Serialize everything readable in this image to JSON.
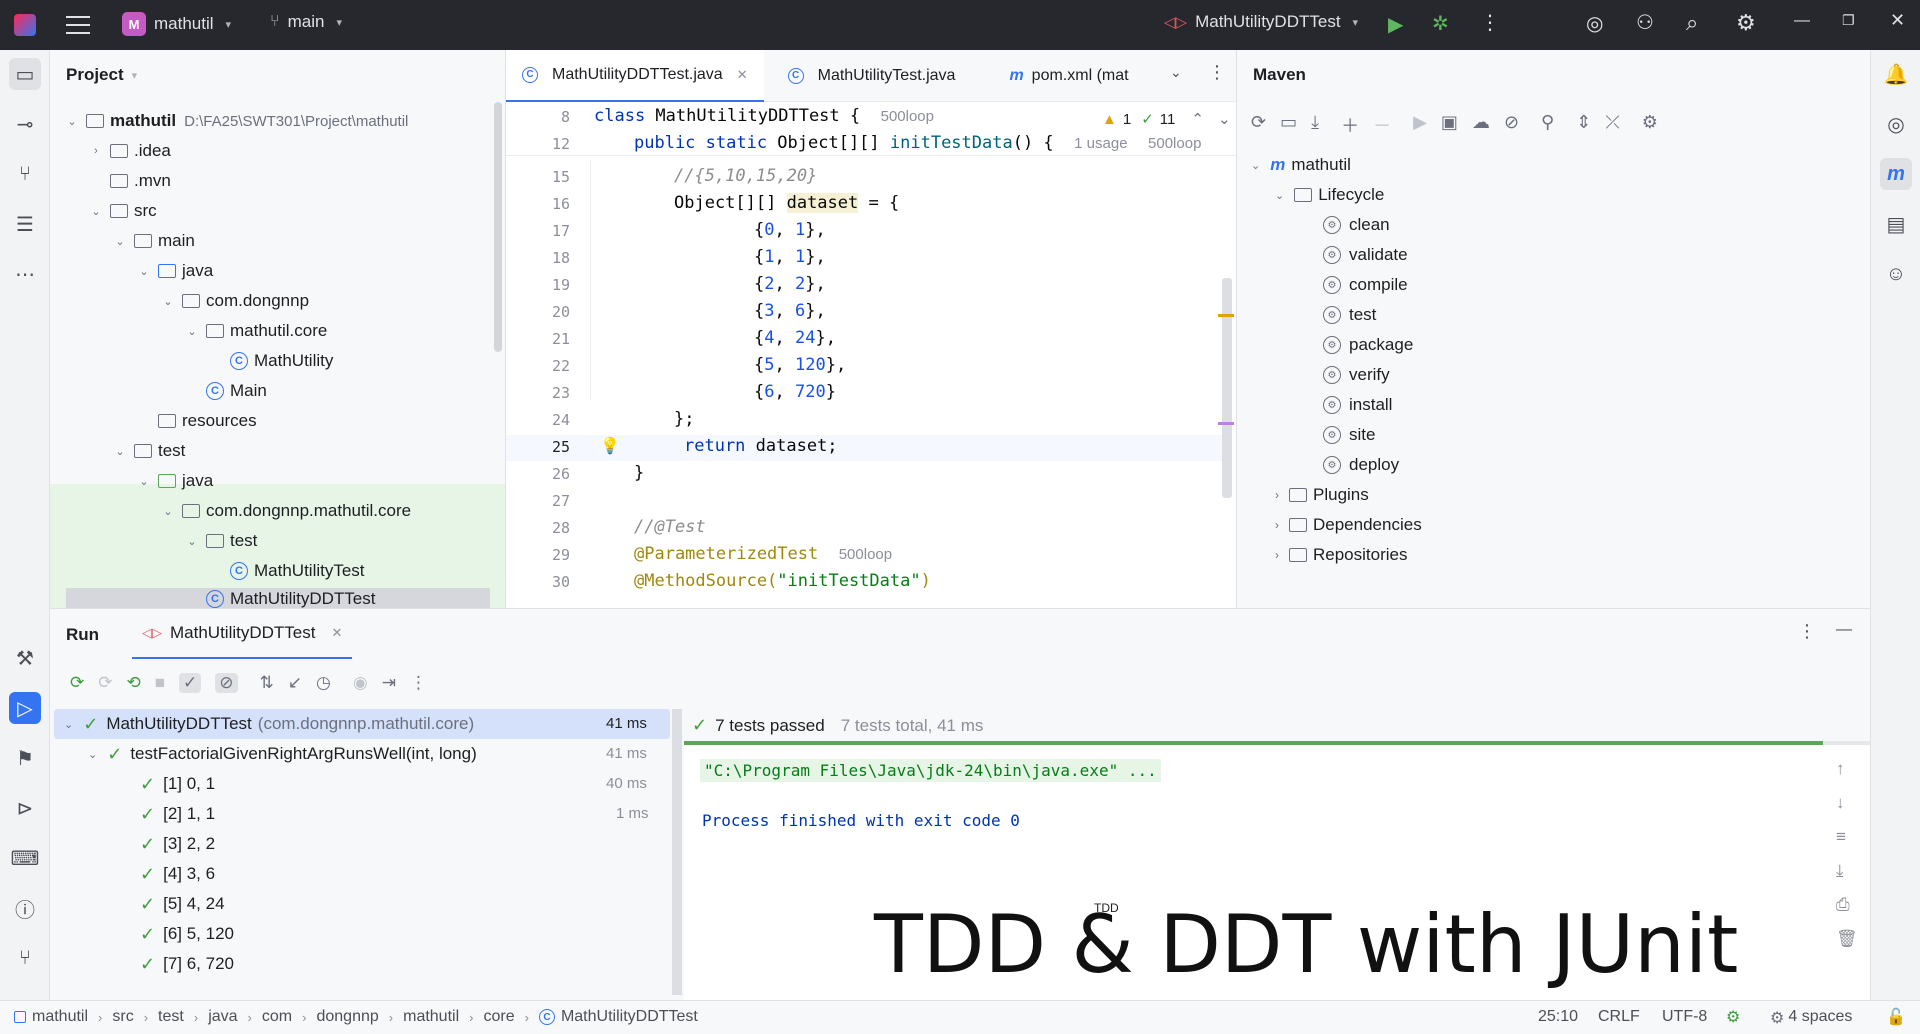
{
  "titlebar": {
    "project_badge": "M",
    "project_name": "mathutil",
    "branch": "main",
    "run_config": "MathUtilityDDTTest"
  },
  "project_panel": {
    "title": "Project",
    "tree": [
      {
        "label": "mathutil",
        "path": "D:\\FA25\\SWT301\\Project\\mathutil"
      },
      {
        "label": ".idea"
      },
      {
        "label": ".mvn"
      },
      {
        "label": "src"
      },
      {
        "label": "main"
      },
      {
        "label": "java"
      },
      {
        "label": "com.dongnnp"
      },
      {
        "label": "mathutil.core"
      },
      {
        "label": "MathUtility"
      },
      {
        "label": "Main"
      },
      {
        "label": "resources"
      },
      {
        "label": "test"
      },
      {
        "label": "java"
      },
      {
        "label": "com.dongnnp.mathutil.core"
      },
      {
        "label": "test"
      },
      {
        "label": "MathUtilityTest"
      },
      {
        "label": "MathUtilityDDTTest"
      }
    ]
  },
  "editor": {
    "tabs": [
      {
        "label": "MathUtilityDDTTest.java"
      },
      {
        "label": "MathUtilityTest.java"
      },
      {
        "label": "pom.xml (mat"
      }
    ],
    "inspections": {
      "warnings": "1",
      "ok": "11"
    },
    "hints": {
      "author": "500loop",
      "usage": "1 usage"
    },
    "lines": [
      {
        "n": "8"
      },
      {
        "n": "12"
      },
      {
        "n": "15"
      },
      {
        "n": "16"
      },
      {
        "n": "17"
      },
      {
        "n": "18"
      },
      {
        "n": "19"
      },
      {
        "n": "20"
      },
      {
        "n": "21"
      },
      {
        "n": "22"
      },
      {
        "n": "23"
      },
      {
        "n": "24"
      },
      {
        "n": "25"
      },
      {
        "n": "26"
      },
      {
        "n": "27"
      },
      {
        "n": "28"
      },
      {
        "n": "29"
      },
      {
        "n": "30"
      }
    ],
    "code": {
      "l8_kw": "class ",
      "l8_name": "MathUtilityDDTTest {",
      "l12_kw": "public static ",
      "l12_type": "Object[][] ",
      "l12_fn": "initTestData",
      "l12_rest": "() {",
      "l15": "//{5,10,15,20}",
      "l16_a": "Object[][] ",
      "l16_b": "dataset",
      "l16_c": " = {",
      "rows": [
        {
          "a": "0",
          "b": "1"
        },
        {
          "a": "1",
          "b": "1"
        },
        {
          "a": "2",
          "b": "2"
        },
        {
          "a": "3",
          "b": "6"
        },
        {
          "a": "4",
          "b": "24"
        },
        {
          "a": "5",
          "b": "120"
        },
        {
          "a": "6",
          "b": "720"
        }
      ],
      "l24": "};",
      "l25_kw": "return ",
      "l25_rest": "dataset;",
      "l26": "}",
      "l28": "//@Test",
      "l29": "@ParameterizedTest",
      "l30_ann": "@MethodSource(",
      "l30_str": "\"initTestData\"",
      "l30_end": ")"
    }
  },
  "maven": {
    "title": "Maven",
    "root": "mathutil",
    "lifecycle_label": "Lifecycle",
    "lifecycle": [
      "clean",
      "validate",
      "compile",
      "test",
      "package",
      "verify",
      "install",
      "site",
      "deploy"
    ],
    "groups": [
      "Plugins",
      "Dependencies",
      "Repositories"
    ]
  },
  "run": {
    "tab_run": "Run",
    "tab_config": "MathUtilityDDTTest",
    "root": {
      "name": "MathUtilityDDTTest",
      "pkg": "(com.dongnnp.mathutil.core)",
      "time": "41 ms"
    },
    "method": {
      "name": "testFactorialGivenRightArgRunsWell(int, long)",
      "time": "41 ms"
    },
    "cases": [
      {
        "label": "[1] 0, 1",
        "time": "40 ms"
      },
      {
        "label": "[2] 1, 1",
        "time": "1 ms"
      },
      {
        "label": "[3] 2, 2",
        "time": ""
      },
      {
        "label": "[4] 3, 6",
        "time": ""
      },
      {
        "label": "[5] 4, 24",
        "time": ""
      },
      {
        "label": "[6] 5, 120",
        "time": ""
      },
      {
        "label": "[7] 6, 720",
        "time": ""
      }
    ],
    "summary": {
      "passed": "7 tests passed",
      "total": "7 tests total, 41 ms"
    },
    "console": {
      "cmd": "\"C:\\Program Files\\Java\\jdk-24\\bin\\java.exe\" ...",
      "exit": "Process finished with exit code 0"
    },
    "overlay": {
      "small": "TDD",
      "big": "TDD & DDT with JUnit"
    }
  },
  "statusbar": {
    "crumbs": [
      "mathutil",
      "src",
      "test",
      "java",
      "com",
      "dongnnp",
      "mathutil",
      "core",
      "MathUtilityDDTTest"
    ],
    "position": "25:10",
    "line_sep": "CRLF",
    "encoding": "UTF-8",
    "indent": "4 spaces"
  }
}
